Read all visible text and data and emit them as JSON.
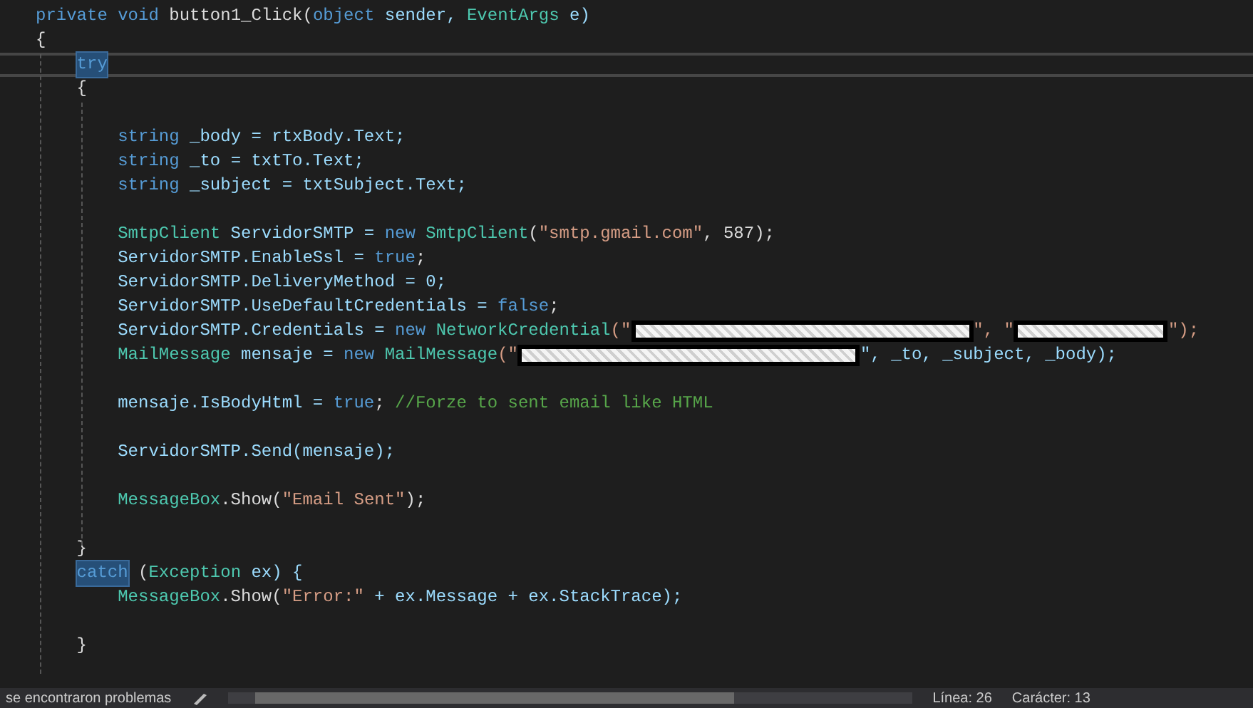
{
  "editor": {
    "lines": [
      {
        "kind": "code",
        "tokens": [
          {
            "text": "private void",
            "kind": "kw"
          },
          {
            "text": " button1_Click(",
            "kind": "plain"
          },
          {
            "text": "object",
            "kind": "kw"
          },
          {
            "text": " sender, ",
            "kind": "var"
          },
          {
            "text": "EventArgs",
            "kind": "type"
          },
          {
            "text": " e)",
            "kind": "var"
          }
        ]
      },
      {
        "kind": "code",
        "tokens": [
          {
            "text": "{",
            "kind": "plain"
          }
        ],
        "children": [
          {
            "kind": "code",
            "current": true,
            "tokens": [
              {
                "text": "try",
                "kind": "kw",
                "highlighted": true
              }
            ]
          },
          {
            "kind": "code",
            "tokens": [
              {
                "text": "{",
                "kind": "plain"
              }
            ],
            "children": [
              {
                "kind": "blank"
              },
              {
                "kind": "code",
                "tokens": [
                  {
                    "text": "string",
                    "kind": "kw"
                  },
                  {
                    "text": " _body = rtxBody.Text;",
                    "kind": "var"
                  }
                ]
              },
              {
                "kind": "code",
                "tokens": [
                  {
                    "text": "string",
                    "kind": "kw"
                  },
                  {
                    "text": " _to = txtTo.Text;",
                    "kind": "var"
                  }
                ]
              },
              {
                "kind": "code",
                "tokens": [
                  {
                    "text": "string",
                    "kind": "kw"
                  },
                  {
                    "text": " _subject = txtSubject.Text;",
                    "kind": "var"
                  }
                ]
              },
              {
                "kind": "blank"
              },
              {
                "kind": "code",
                "tokens": [
                  {
                    "text": "SmtpClient",
                    "kind": "type"
                  },
                  {
                    "text": " ServidorSMTP = ",
                    "kind": "var"
                  },
                  {
                    "text": "new",
                    "kind": "kw"
                  },
                  {
                    "text": " SmtpClient",
                    "kind": "type"
                  },
                  {
                    "text": "(",
                    "kind": "plain"
                  },
                  {
                    "text": "\"smtp.gmail.com\"",
                    "kind": "str"
                  },
                  {
                    "text": ", 587);",
                    "kind": "plain"
                  }
                ]
              },
              {
                "kind": "code",
                "tokens": [
                  {
                    "text": "ServidorSMTP.EnableSsl = ",
                    "kind": "var"
                  },
                  {
                    "text": "true",
                    "kind": "kw"
                  },
                  {
                    "text": ";",
                    "kind": "plain"
                  }
                ]
              },
              {
                "kind": "code",
                "tokens": [
                  {
                    "text": "ServidorSMTP.DeliveryMethod = 0;",
                    "kind": "var"
                  }
                ]
              },
              {
                "kind": "code",
                "tokens": [
                  {
                    "text": "ServidorSMTP.UseDefaultCredentials = ",
                    "kind": "var"
                  },
                  {
                    "text": "false",
                    "kind": "kw"
                  },
                  {
                    "text": ";",
                    "kind": "plain"
                  }
                ]
              },
              {
                "kind": "code",
                "tokens": [
                  {
                    "text": "ServidorSMTP.Credentials = ",
                    "kind": "var"
                  },
                  {
                    "text": "new",
                    "kind": "kw"
                  },
                  {
                    "text": " NetworkCredential",
                    "kind": "type"
                  },
                  {
                    "text": "(\"",
                    "kind": "str"
                  },
                  {
                    "kind": "redacted_long"
                  },
                  {
                    "text": "\", \"",
                    "kind": "str"
                  },
                  {
                    "kind": "redacted_short"
                  },
                  {
                    "text": "\");",
                    "kind": "str"
                  }
                ]
              },
              {
                "kind": "code",
                "tokens": [
                  {
                    "text": "MailMessage",
                    "kind": "type"
                  },
                  {
                    "text": " mensaje = ",
                    "kind": "var"
                  },
                  {
                    "text": "new",
                    "kind": "kw"
                  },
                  {
                    "text": " MailMessage",
                    "kind": "type"
                  },
                  {
                    "text": "(\"",
                    "kind": "str"
                  },
                  {
                    "kind": "redacted_long"
                  },
                  {
                    "text": "\", _to, _subject, _body);",
                    "kind": "var"
                  }
                ]
              },
              {
                "kind": "blank"
              },
              {
                "kind": "code",
                "tokens": [
                  {
                    "text": "mensaje.IsBodyHtml = ",
                    "kind": "var"
                  },
                  {
                    "text": "true",
                    "kind": "kw"
                  },
                  {
                    "text": ";",
                    "kind": "plain"
                  },
                  {
                    "text": " //Forze to sent email like HTML",
                    "kind": "cmt"
                  }
                ]
              },
              {
                "kind": "blank"
              },
              {
                "kind": "code",
                "tokens": [
                  {
                    "text": "ServidorSMTP.Send(mensaje);",
                    "kind": "var"
                  }
                ]
              },
              {
                "kind": "blank"
              },
              {
                "kind": "code",
                "tokens": [
                  {
                    "text": "MessageBox",
                    "kind": "type"
                  },
                  {
                    "text": ".Show(",
                    "kind": "plain"
                  },
                  {
                    "text": "\"Email Sent\"",
                    "kind": "str"
                  },
                  {
                    "text": ");",
                    "kind": "plain"
                  }
                ]
              },
              {
                "kind": "blank"
              }
            ]
          },
          {
            "kind": "code",
            "tokens": [
              {
                "text": "}",
                "kind": "plain"
              }
            ]
          },
          {
            "kind": "code",
            "tokens": [
              {
                "text": "catch",
                "kind": "kw",
                "highlighted": true
              },
              {
                "text": " (",
                "kind": "plain"
              },
              {
                "text": "Exception",
                "kind": "type"
              },
              {
                "text": " ex) {",
                "kind": "var"
              }
            ],
            "children": [
              {
                "kind": "code",
                "tokens": [
                  {
                    "text": "MessageBox",
                    "kind": "type"
                  },
                  {
                    "text": ".Show(",
                    "kind": "plain"
                  },
                  {
                    "text": "\"Error:\"",
                    "kind": "str"
                  },
                  {
                    "text": " + ex.Message + ex.StackTrace);",
                    "kind": "var"
                  }
                ]
              },
              {
                "kind": "blank"
              }
            ]
          },
          {
            "kind": "code",
            "tokens": [
              {
                "text": "}",
                "kind": "plain"
              }
            ]
          }
        ]
      }
    ]
  },
  "status_bar": {
    "problems": "se encontraron problemas",
    "line": "Línea: 26",
    "column": "Carácter: 13"
  }
}
